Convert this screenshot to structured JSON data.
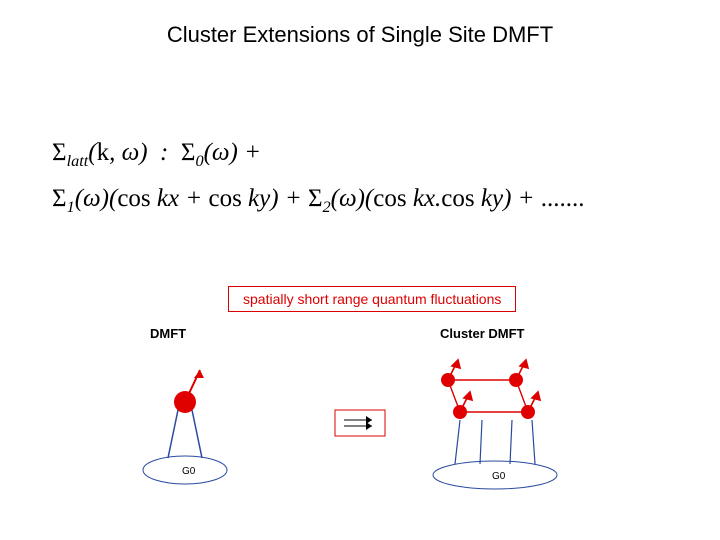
{
  "title": "Cluster Extensions of Single Site DMFT",
  "equation": {
    "line1_html": "Σ<sub>latt</sub>(k, ω) :  Σ<sub>0</sub>(ω) +",
    "line2_html": "Σ<sub>1</sub>(ω)(cos kx + cos ky) + Σ<sub>2</sub>(ω)(cos kx · cos ky) + ......."
  },
  "figure": {
    "banner": "spatially short range quantum fluctuations",
    "left_label": "DMFT",
    "right_label": "Cluster DMFT",
    "bath_label": "G0",
    "arrow": "⇒"
  },
  "diagram_data": {
    "type": "schematic",
    "left": {
      "label": "DMFT",
      "sites": [
        {
          "x": 0,
          "y": 0
        }
      ],
      "bath": true
    },
    "right": {
      "label": "Cluster DMFT",
      "sites": [
        {
          "x": 0,
          "y": 0
        },
        {
          "x": 1,
          "y": 0
        },
        {
          "x": 0,
          "y": 1
        },
        {
          "x": 1,
          "y": 1
        }
      ],
      "bath": true
    },
    "relation": "left → right (cluster extension)"
  }
}
